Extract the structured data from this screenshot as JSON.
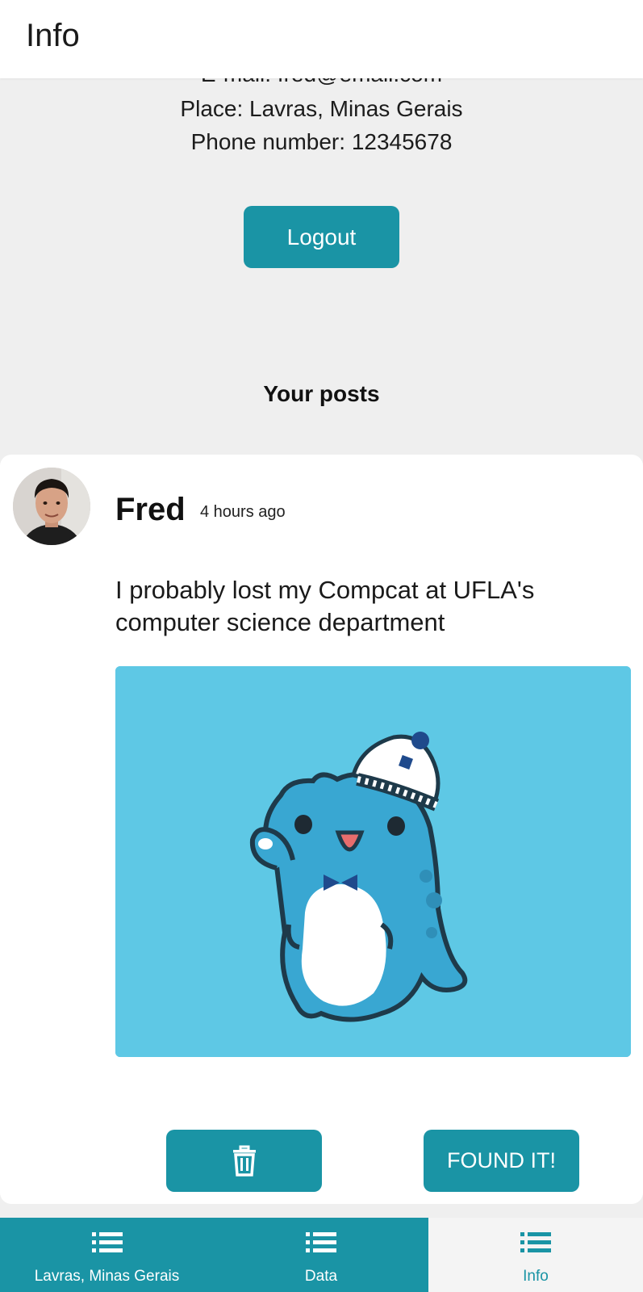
{
  "app_bar": {
    "title": "Info"
  },
  "profile": {
    "email": "E-mail: fred@email.com",
    "place": "Place: Lavras, Minas Gerais",
    "phone": "Phone number: 12345678"
  },
  "logout_label": "Logout",
  "posts_heading": "Your posts",
  "post": {
    "author": "Fred",
    "time": "4 hours ago",
    "text": "I probably lost my Compcat at UFLA's computer science department",
    "delete_icon": "trash-icon",
    "found_label": "FOUND IT!"
  },
  "nav": {
    "items": [
      {
        "label": "Lavras, Minas Gerais",
        "icon": "list-icon"
      },
      {
        "label": "Data",
        "icon": "list-icon"
      },
      {
        "label": "Info",
        "icon": "list-icon"
      }
    ]
  },
  "colors": {
    "accent": "#1a94a5",
    "background": "#efefef",
    "image_bg": "#5ec8e5"
  }
}
